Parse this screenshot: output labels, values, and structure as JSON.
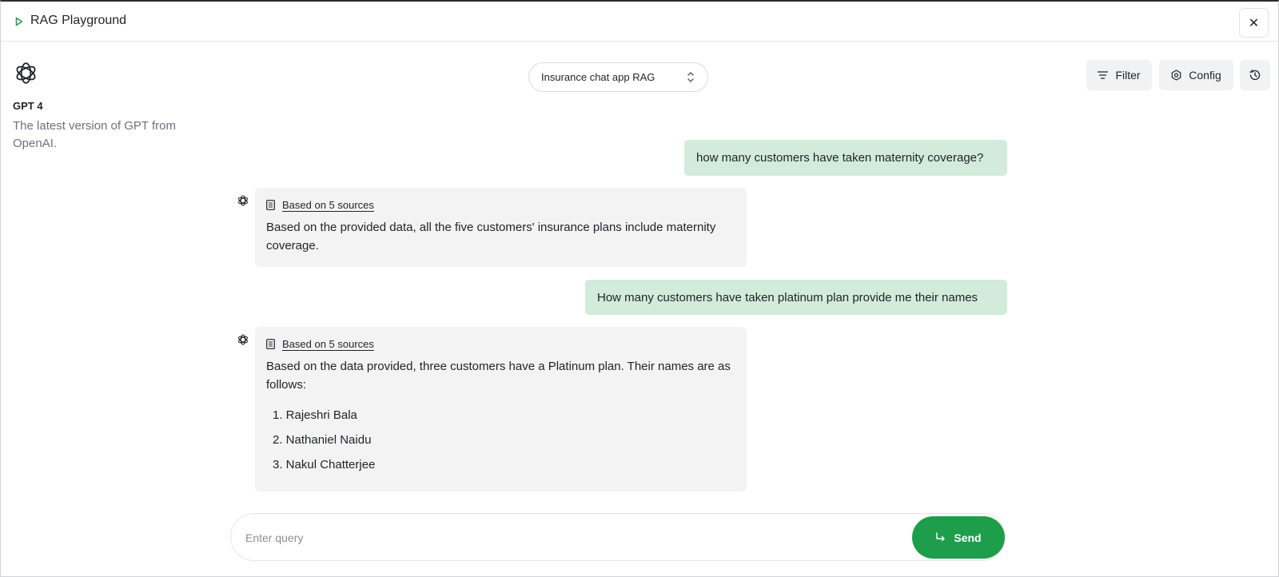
{
  "window": {
    "title": "RAG Playground",
    "close_glyph": "✕"
  },
  "model": {
    "icon": "openai-logo-icon",
    "name": "GPT 4",
    "description": "The latest version of GPT from OpenAI."
  },
  "project_selector": {
    "value": "Insurance chat app RAG"
  },
  "toolbar": {
    "filter_label": "Filter",
    "config_label": "Config",
    "history_icon": "history-icon"
  },
  "messages": [
    {
      "role": "user",
      "text": "how many customers have taken maternity coverage?"
    },
    {
      "role": "assistant",
      "sources_label": "Based on 5 sources",
      "text": "Based on the provided data, all the five customers' insurance plans include maternity coverage."
    },
    {
      "role": "user",
      "text": "How many customers have taken platinum plan provide me their names"
    },
    {
      "role": "assistant",
      "sources_label": "Based on 5 sources",
      "text": "Based on the data provided, three customers have a Platinum plan. Their names are as follows:",
      "list": [
        "1. Rajeshri Bala",
        "2. Nathaniel Naidu",
        "3. Nakul Chatterjee"
      ]
    }
  ],
  "composer": {
    "placeholder": "Enter query",
    "value": "",
    "send_label": "Send"
  },
  "colors": {
    "accent": "#1e9e4a",
    "user_bubble": "#d2ebdb",
    "bot_bubble": "#f3f3f3"
  }
}
